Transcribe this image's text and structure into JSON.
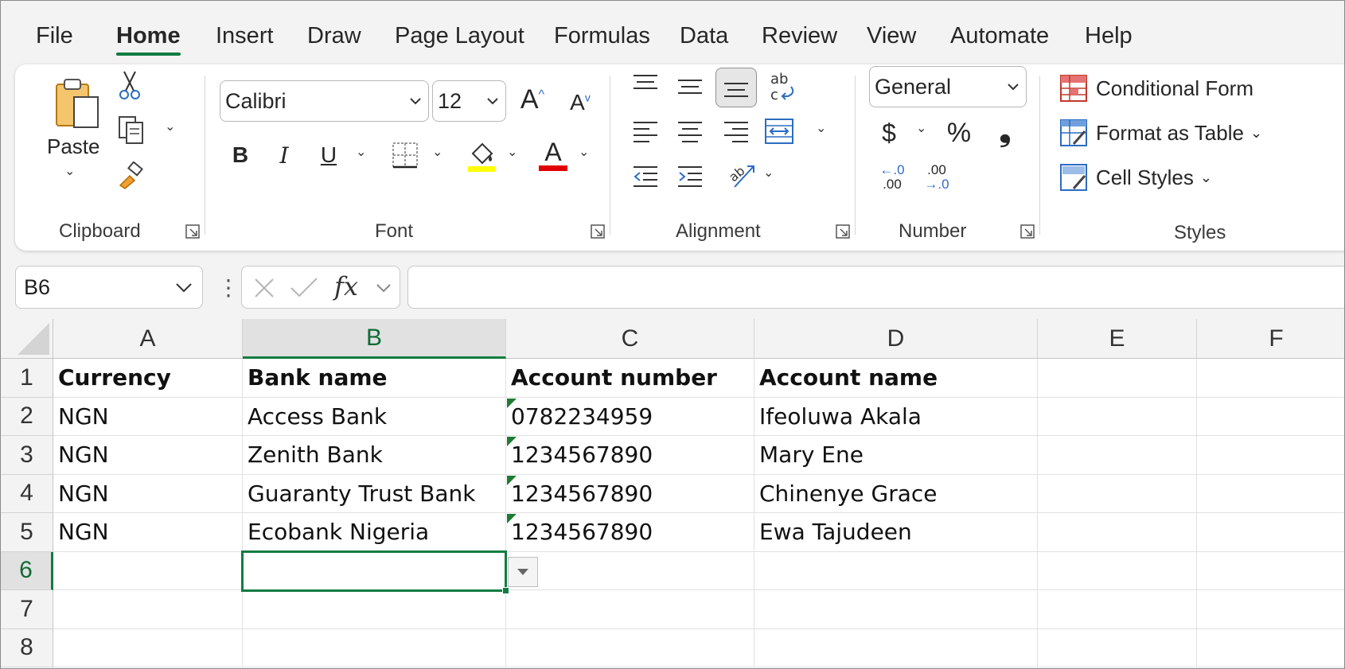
{
  "menu": {
    "tabs": [
      "File",
      "Home",
      "Insert",
      "Draw",
      "Page Layout",
      "Formulas",
      "Data",
      "Review",
      "View",
      "Automate",
      "Help"
    ],
    "active": "Home"
  },
  "ribbon": {
    "clipboard": {
      "paste_label": "Paste",
      "group_label": "Clipboard"
    },
    "font": {
      "font_name": "Calibri",
      "font_size": "12",
      "group_label": "Font",
      "bold_label": "B",
      "italic_label": "I",
      "underline_label": "U",
      "font_color_label": "A"
    },
    "alignment": {
      "group_label": "Alignment"
    },
    "number": {
      "format": "General",
      "currency_label": "$",
      "percent_label": "%",
      "comma_label": "❟",
      "inc_decimal_top": "←.0",
      "inc_decimal_bottom": ".00",
      "dec_decimal_top": ".00",
      "dec_decimal_bottom": "→.0",
      "group_label": "Number"
    },
    "styles": {
      "conditional_label": "Conditional Form",
      "format_table_label": "Format as Table",
      "cell_styles_label": "Cell Styles",
      "group_label": "Styles"
    }
  },
  "formula_bar": {
    "name_box": "B6",
    "fx_label": "fx",
    "formula": ""
  },
  "colors": {
    "accent": "#107c41",
    "fill_color": "#ffff00",
    "font_color": "#e00000"
  },
  "sheet": {
    "columns": [
      "A",
      "B",
      "C",
      "D",
      "E",
      "F"
    ],
    "rows": [
      "1",
      "2",
      "3",
      "4",
      "5",
      "6",
      "7",
      "8"
    ],
    "selected_cell": "B6",
    "cells": [
      [
        "Currency",
        "Bank name",
        "Account number",
        "Account name",
        "",
        ""
      ],
      [
        "NGN",
        "Access Bank",
        "0782234959",
        "Ifeoluwa Akala",
        "",
        ""
      ],
      [
        "NGN",
        "Zenith Bank",
        "1234567890",
        "Mary Ene",
        "",
        ""
      ],
      [
        "NGN",
        "Guaranty Trust Bank",
        "1234567890",
        "Chinenye Grace",
        "",
        ""
      ],
      [
        "NGN",
        "Ecobank Nigeria",
        "1234567890",
        "Ewa Tajudeen",
        "",
        ""
      ],
      [
        "",
        "",
        "",
        "",
        "",
        ""
      ],
      [
        "",
        "",
        "",
        "",
        "",
        ""
      ],
      [
        "",
        "",
        "",
        "",
        "",
        ""
      ]
    ]
  }
}
